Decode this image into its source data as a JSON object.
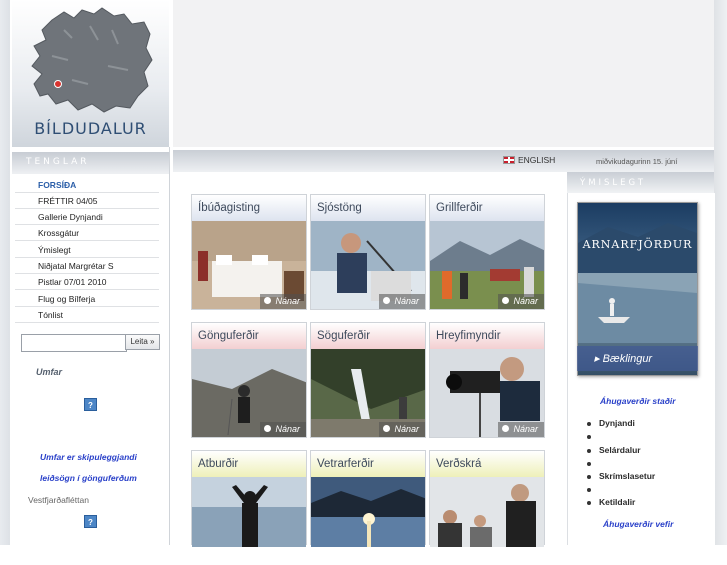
{
  "logo": {
    "title": "BÍLDUDALUR"
  },
  "sidebar": {
    "heading": "TENGLAR",
    "items": [
      {
        "label": "FORSÍÐA",
        "active": true
      },
      {
        "label": "FRÉTTIR 04/05"
      },
      {
        "label": "Gallerie Dynjandi"
      },
      {
        "label": "Krossgátur"
      },
      {
        "label": "Ýmislegt"
      },
      {
        "label": "Niðjatal Margrétar S"
      },
      {
        "label": "Pistlar 07/01 2010"
      },
      {
        "label": "Flug og Bílferja"
      },
      {
        "label": "Tónlist"
      }
    ],
    "search": {
      "value": "",
      "button_label": "Leita »"
    },
    "umfar_label": "Umfar",
    "help_icon_glyph": "?",
    "umfar_text_line1": "Umfar er skipuleggjandi",
    "umfar_text_line2": "leiðsögn í gönguferðum",
    "vest_label": "Vestfjarðafléttan"
  },
  "header": {
    "english_label": "ENGLISH",
    "date": "miðvikudagurinn 15. júní"
  },
  "tiles": [
    {
      "title": "Íbúðagisting",
      "color": "blue",
      "more": "Nánar"
    },
    {
      "title": "Sjóstöng",
      "color": "blue",
      "more": "Nánar"
    },
    {
      "title": "Grillferðir",
      "color": "blue",
      "more": "Nánar"
    },
    {
      "title": "Gönguferðir",
      "color": "pink",
      "more": "Nánar"
    },
    {
      "title": "Söguferðir",
      "color": "pink",
      "more": "Nánar"
    },
    {
      "title": "Hreyfimyndir",
      "color": "pink",
      "more": "Nánar"
    },
    {
      "title": "Atburðir",
      "color": "yellow",
      "more": ""
    },
    {
      "title": "Vetrarferðir",
      "color": "yellow",
      "more": ""
    },
    {
      "title": "Verðskrá",
      "color": "yellow",
      "more": ""
    }
  ],
  "right": {
    "heading": "ÝMISLEGT",
    "brochure_title": "ARNARFJÖRÐUR",
    "brochure_subtitle": "Bæklingur",
    "places_heading": "Áhugaverðir staðir",
    "places": [
      "Dynjandi",
      "",
      "Selárdalur",
      "",
      "Skrímslasetur",
      "",
      "Ketildalir"
    ],
    "webs_heading": "Áhugaverðir vefir"
  },
  "colors": {
    "link_blue": "#2a41c9",
    "title_text": "#3e4a5c",
    "logo_text": "#2f4e74"
  }
}
